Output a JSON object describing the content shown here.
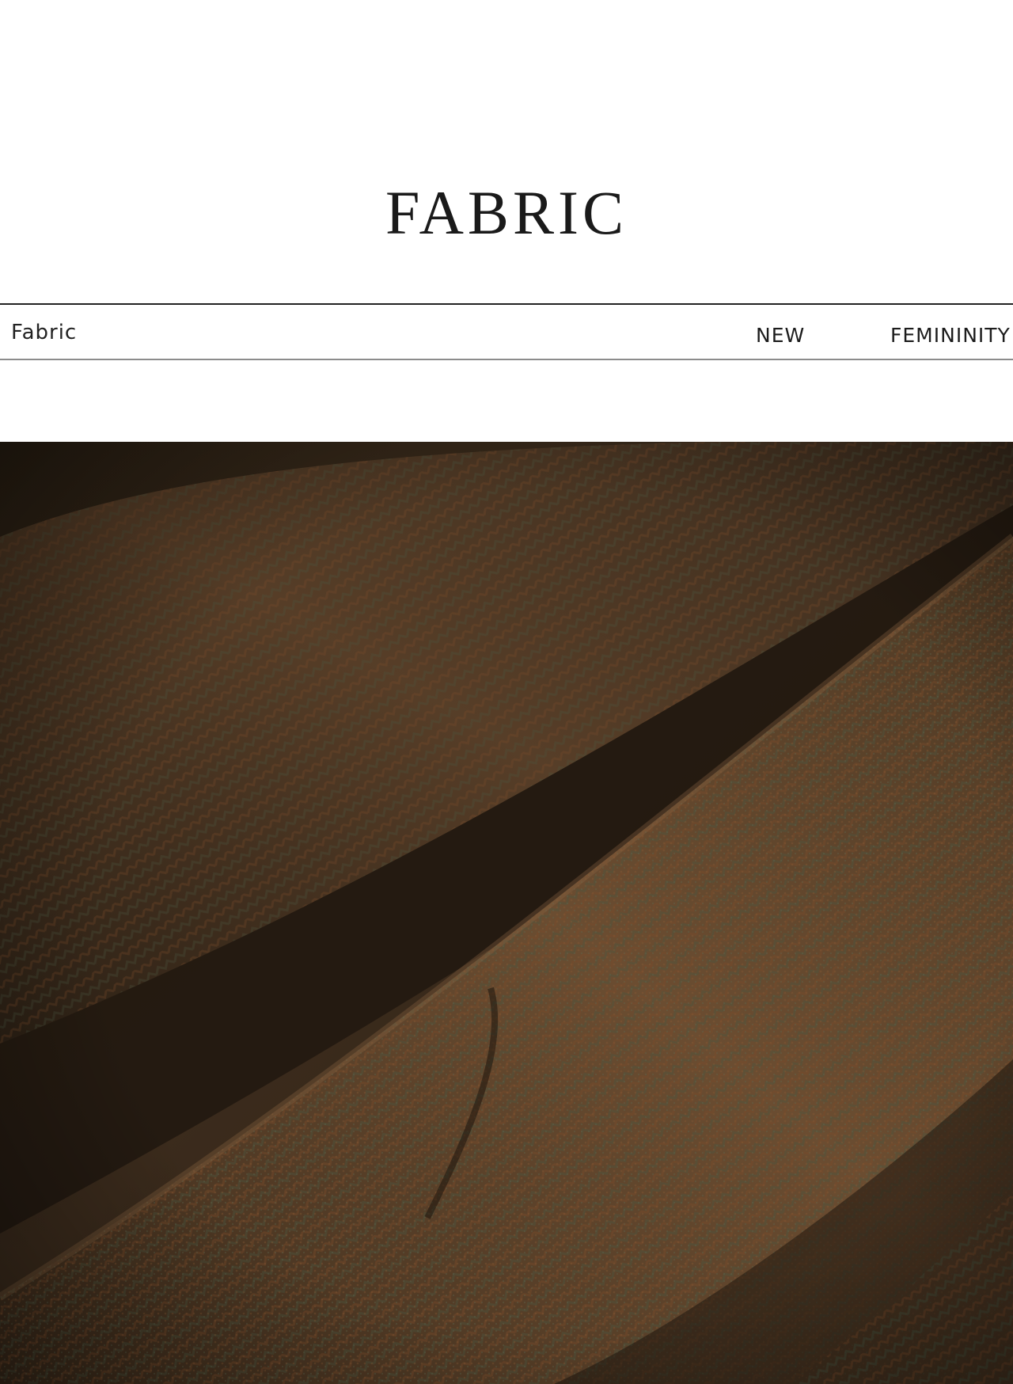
{
  "page": {
    "title": "FABRIC"
  },
  "nav": {
    "left_label": "Fabric",
    "items": [
      {
        "label": "NEW"
      },
      {
        "label": "FEMININITY"
      }
    ]
  },
  "photo": {
    "subject": "close-up of brown-green herringbone wool tweed fabric",
    "colors": {
      "shadow": "#1f1810",
      "mid": "#4a3724",
      "highlight": "#6f5236",
      "green": "#48503a",
      "rust": "#7a4424"
    }
  }
}
